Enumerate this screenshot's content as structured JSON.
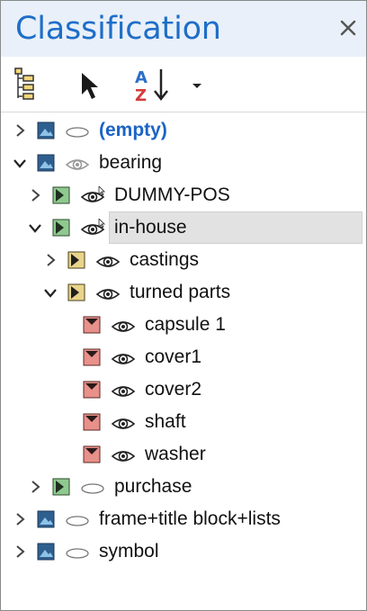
{
  "panel": {
    "title": "Classification",
    "close_label": "×"
  },
  "toolbar": {
    "buttons": [
      "tree-structure-icon",
      "select-arrow-icon",
      "sort-az-icon",
      "dropdown-arrow-icon"
    ]
  },
  "colors": {
    "title": "#1e6ec8",
    "group_blue": "#2f5f8f",
    "group_green": "#8fc98f",
    "group_yellow": "#e8d58a",
    "group_red": "#e8908a"
  },
  "tree": {
    "items": [
      {
        "label": "(empty)",
        "level": 0,
        "expander": "collapsed",
        "icon": "blue-mountain-icon",
        "eye": "ellipse",
        "bold": true
      },
      {
        "label": "bearing",
        "level": 0,
        "expander": "expanded",
        "icon": "blue-mountain-icon",
        "eye": "eye-grey"
      },
      {
        "label": "DUMMY-POS",
        "level": 1,
        "expander": "collapsed",
        "icon": "green-flag-icon",
        "eye": "eye-with-cursor"
      },
      {
        "label": "in-house",
        "level": 1,
        "expander": "expanded",
        "icon": "green-flag-icon",
        "eye": "eye-with-cursor",
        "selected": true
      },
      {
        "label": "castings",
        "level": 2,
        "expander": "collapsed",
        "icon": "yellow-flag-icon",
        "eye": "eye"
      },
      {
        "label": "turned parts",
        "level": 2,
        "expander": "expanded",
        "icon": "yellow-flag-icon",
        "eye": "eye"
      },
      {
        "label": "capsule 1",
        "level": 3,
        "expander": "none",
        "icon": "red-m-icon",
        "eye": "eye"
      },
      {
        "label": "cover1",
        "level": 3,
        "expander": "none",
        "icon": "red-m-icon",
        "eye": "eye"
      },
      {
        "label": "cover2",
        "level": 3,
        "expander": "none",
        "icon": "red-m-icon",
        "eye": "eye"
      },
      {
        "label": "shaft",
        "level": 3,
        "expander": "none",
        "icon": "red-m-icon",
        "eye": "eye"
      },
      {
        "label": "washer",
        "level": 3,
        "expander": "none",
        "icon": "red-m-icon",
        "eye": "eye"
      },
      {
        "label": "purchase",
        "level": 1,
        "expander": "collapsed",
        "icon": "green-flag-icon",
        "eye": "ellipse"
      },
      {
        "label": "frame+title block+lists",
        "level": 0,
        "expander": "collapsed",
        "icon": "blue-mountain-icon",
        "eye": "ellipse"
      },
      {
        "label": "symbol",
        "level": 0,
        "expander": "collapsed",
        "icon": "blue-mountain-icon",
        "eye": "ellipse"
      }
    ]
  }
}
